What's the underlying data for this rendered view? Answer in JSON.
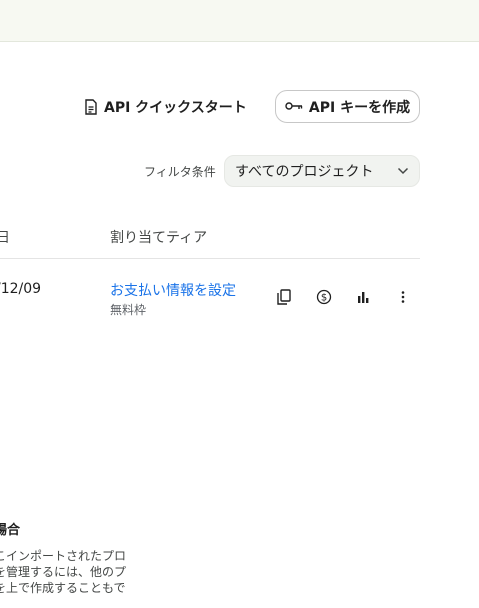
{
  "toolbar": {
    "quickstart_label": "API クイックスタート",
    "create_key_label": "API キーを作成"
  },
  "filter": {
    "label": "フィルタ条件",
    "selected": "すべてのプロジェクト"
  },
  "table": {
    "headers": {
      "date": "日",
      "tier": "割り当てティア"
    },
    "rows": [
      {
        "date": "/12/09",
        "tier_link": "お支払い情報を設定",
        "tier_sub": "無料枠"
      }
    ]
  },
  "info_section": {
    "title": "場合",
    "lines": [
      "こインポートされたプロ",
      "を管理するには、他のプ",
      "を上で作成することもで"
    ]
  },
  "colors": {
    "link": "#1a73e8",
    "banner": "#f7f9f2"
  },
  "icons": [
    "document-icon",
    "key-icon",
    "chevron-down-icon",
    "copy-icon",
    "billing-icon",
    "bar-chart-icon",
    "more-vert-icon"
  ]
}
